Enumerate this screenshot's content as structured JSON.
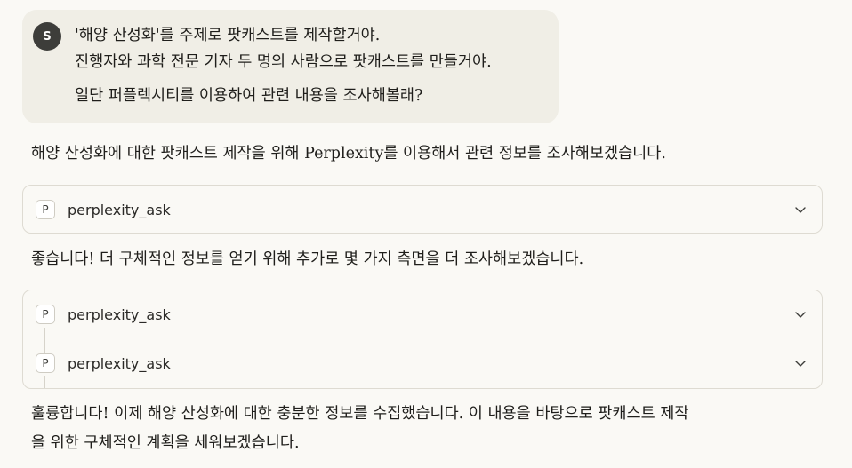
{
  "user_message": {
    "avatar_initial": "S",
    "lines": [
      "'해양 산성화'를 주제로 팟캐스트를 제작할거야.",
      "진행자와 과학 전문 기자 두 명의 사람으로 팟캐스트를 만들거야.",
      "일단 퍼플렉시티를 이용하여 관련 내용을 조사해볼래?"
    ]
  },
  "assistant": {
    "intro": "해양 산성화에 대한 팟캐스트 제작을 위해 Perplexity를 이용해서 관련 정보를 조사해보겠습니다.",
    "followup": "좋습니다! 더 구체적인 정보를 얻기 위해 추가로 몇 가지 측면을 더 조사해보겠습니다.",
    "final_line1": "훌륭합니다! 이제 해양 산성화에 대한 충분한 정보를 수집했습니다. 이 내용을 바탕으로 팟캐스트 제작",
    "final_line2": "을 위한 구체적인 계획을 세워보겠습니다."
  },
  "tool_calls": {
    "first": {
      "badge": "P",
      "name": "perplexity_ask"
    },
    "group": [
      {
        "badge": "P",
        "name": "perplexity_ask"
      },
      {
        "badge": "P",
        "name": "perplexity_ask"
      }
    ]
  },
  "icons": {
    "expand": "chevron-down-icon"
  },
  "colors": {
    "background": "#faf9f5",
    "user_bubble": "#f0eee6",
    "avatar": "#3d3d3a",
    "card_border": "#dedbd2"
  }
}
